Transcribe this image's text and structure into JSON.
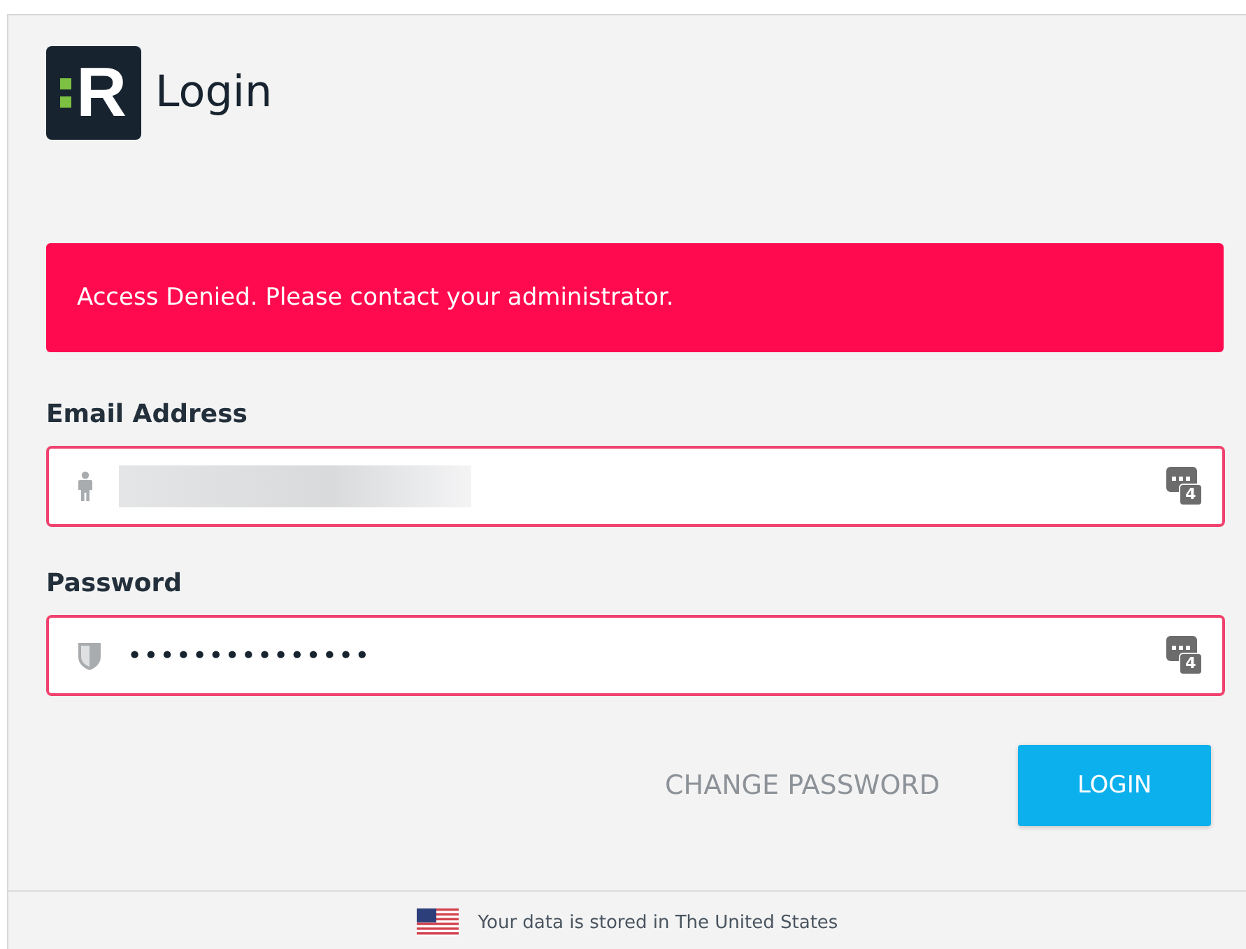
{
  "logo": {
    "letter": "R"
  },
  "title": "Login",
  "alert": {
    "message": "Access Denied. Please contact your administrator."
  },
  "fields": [
    {
      "label": "Email Address",
      "kind": "email",
      "value_blurred": true,
      "invalid": true,
      "badge": "4"
    },
    {
      "label": "Password",
      "kind": "password",
      "value": "•••••••••••••••",
      "invalid": true,
      "badge": "4"
    }
  ],
  "buttons": [
    {
      "label": "CHANGE PASSWORD",
      "kind": "text"
    },
    {
      "label": "LOGIN",
      "kind": "primary"
    }
  ],
  "footer": {
    "text": "Your data is stored in The United States"
  }
}
